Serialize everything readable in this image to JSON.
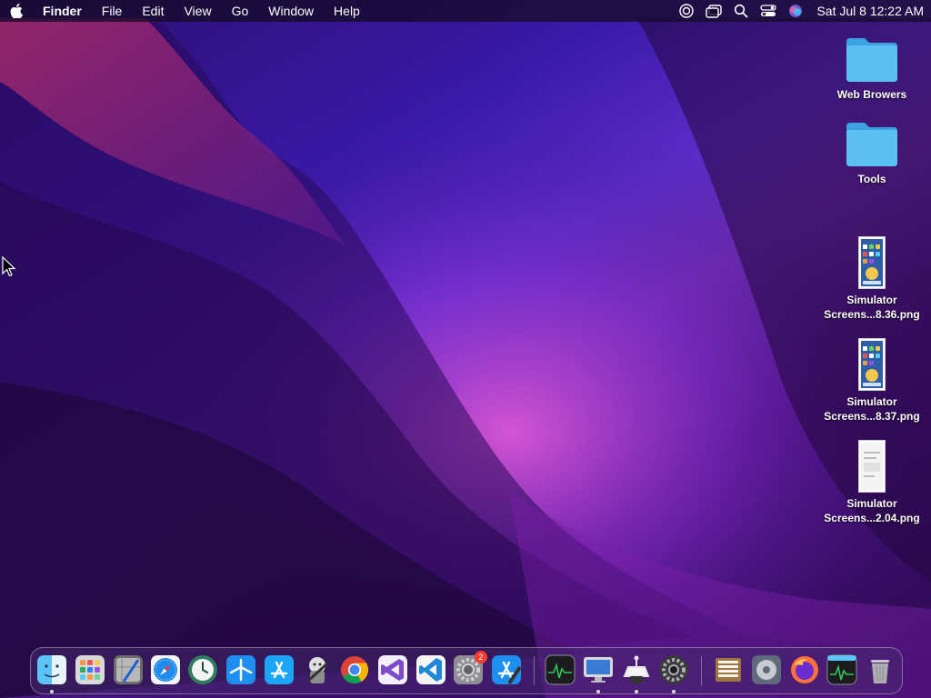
{
  "menubar": {
    "app_name": "Finder",
    "menus": [
      "File",
      "Edit",
      "View",
      "Go",
      "Window",
      "Help"
    ],
    "status_icons": [
      "screen-time-icon",
      "window-switch-icon",
      "spotlight-search-icon",
      "control-center-icon",
      "siri-icon"
    ],
    "clock": "Sat Jul 8  12:22 AM"
  },
  "desktop_icons": [
    {
      "label": "Web Browers",
      "kind": "folder-icon"
    },
    {
      "label": "Tools",
      "kind": "folder-icon"
    },
    {
      "label_line1": "Simulator",
      "label_line2": "Screens...8.36.png",
      "kind": "png-thumbnail-icon"
    },
    {
      "label_line1": "Simulator",
      "label_line2": "Screens...8.37.png",
      "kind": "png-thumbnail-icon"
    },
    {
      "label_line1": "Simulator",
      "label_line2": "Screens...2.04.png",
      "kind": "png-thumbnail-icon"
    }
  ],
  "dock": {
    "apps": [
      "finder-icon",
      "launchpad-icon",
      "xcode-instruments-icon",
      "safari-icon",
      "time-machine-icon",
      "testflight-icon",
      "app-store-icon",
      "automator-icon",
      "google-chrome-icon",
      "visual-studio-icon",
      "vscode-icon",
      "system-preferences-icon",
      "xcode-icon"
    ],
    "system_settings_badge": "2",
    "recent_apps": [
      "activity-monitor-icon",
      "simulator-icon",
      "transporter-icon",
      "settings-gear-icon"
    ],
    "other_items": [
      "archive-utility-icon",
      "disk-utility-icon",
      "firefox-icon",
      "activity-monitor-alt-icon",
      "trash-icon"
    ]
  },
  "colors": {
    "menubar_bg": "#140a28",
    "folder_blue": "#4fb6ef",
    "badge_red": "#ff3b30"
  }
}
